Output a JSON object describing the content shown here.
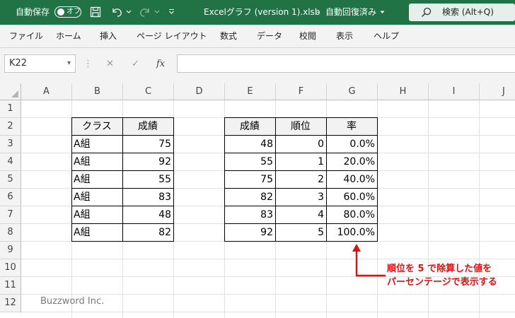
{
  "titlebar": {
    "autosave_label": "自動保存",
    "autosave_state": "オフ",
    "filename": "Excelグラフ (version 1).xlsb",
    "separator": "-",
    "save_status": "自動回復済み",
    "search_label": "検索 (Alt+Q)",
    "accent_color": "#217346"
  },
  "ribbon": {
    "tabs": [
      "ファイル",
      "ホーム",
      "挿入",
      "ページ レイアウト",
      "数式",
      "データ",
      "校閲",
      "表示",
      "ヘルプ"
    ]
  },
  "formula_bar": {
    "name_box": "K22",
    "fx": "fx",
    "content": ""
  },
  "columns": [
    "A",
    "B",
    "C",
    "D",
    "E",
    "F",
    "G",
    "H",
    "I",
    "J"
  ],
  "rows": [
    "1",
    "2",
    "3",
    "4",
    "5",
    "6",
    "7",
    "8",
    "9",
    "10",
    "11",
    "12"
  ],
  "table1": {
    "headers": [
      "クラス",
      "成績"
    ],
    "rows": [
      [
        "A組",
        "75"
      ],
      [
        "A組",
        "92"
      ],
      [
        "A組",
        "55"
      ],
      [
        "A組",
        "83"
      ],
      [
        "A組",
        "48"
      ],
      [
        "A組",
        "82"
      ]
    ]
  },
  "table2": {
    "headers": [
      "成績",
      "順位",
      "率"
    ],
    "rows": [
      [
        "48",
        "0",
        "0.0%"
      ],
      [
        "55",
        "1",
        "20.0%"
      ],
      [
        "75",
        "2",
        "40.0%"
      ],
      [
        "82",
        "3",
        "60.0%"
      ],
      [
        "83",
        "4",
        "80.0%"
      ],
      [
        "92",
        "5",
        "100.0%"
      ]
    ]
  },
  "annotation": {
    "line1": "順位を 5 で除算した値を",
    "line2": "パーセンテージで表示する",
    "color": "#dd1111"
  },
  "watermark": "Buzzword Inc."
}
